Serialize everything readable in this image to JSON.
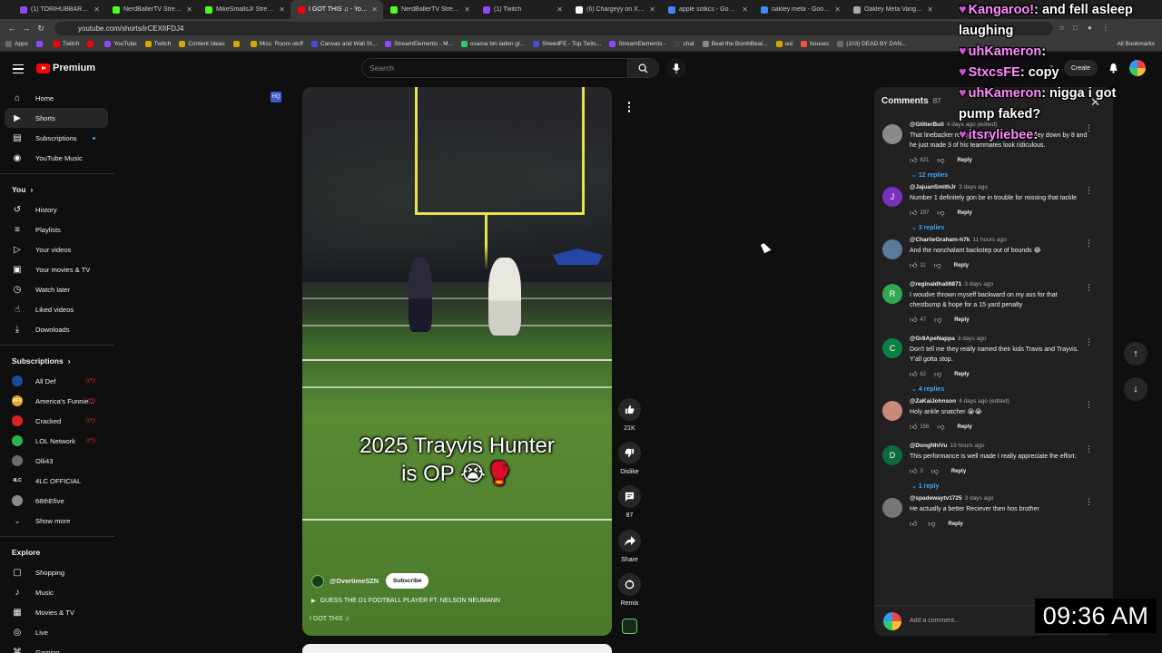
{
  "browser": {
    "tabs": [
      {
        "label": "(1) TORIHUBBARD - Twitc",
        "color": "#9146ff"
      },
      {
        "label": "NerdBallerTV Stream - W",
        "color": "#53fc18"
      },
      {
        "label": "MikeSmallsJr Stream - W",
        "color": "#53fc18"
      },
      {
        "label": "I GOT THIS ♫ - YouTu",
        "color": "#ff0000",
        "active": true
      },
      {
        "label": "NerdBallerTV Stream - W",
        "color": "#53fc18"
      },
      {
        "label": "(1) Twitch",
        "color": "#9146ff"
      },
      {
        "label": "(6) Chargeyy on X: \"Offic",
        "color": "#ffffff"
      },
      {
        "label": "apple sotkcs - Google Se",
        "color": "#4285f4"
      },
      {
        "label": "oakley meta - Google Sea",
        "color": "#4285f4"
      },
      {
        "label": "Oakley Meta Vanguard P",
        "color": "#aaaaaa"
      }
    ],
    "url": "youtube.com/shorts/irCEXItFDJ4",
    "bookmarks": [
      "Apps",
      "",
      "Twitch",
      "",
      "YouTube",
      "Twitch",
      "Content Ideas",
      "",
      "Misc. Room stuff",
      "Canvas and Wall St...",
      "StreamElements - M...",
      "osama bin laden gr...",
      "SheedFE - Top Twitc...",
      "StreamElements -",
      "chat",
      "Beat the BombBeat...",
      "ooi",
      "houses",
      "(103) DEAD BY DAN..."
    ],
    "all_bookmarks": "All Bookmarks"
  },
  "youtube": {
    "logo_text": "Premium",
    "search_placeholder": "Search",
    "header_counter": "2",
    "create_label": "Create"
  },
  "sidebar": {
    "top": [
      {
        "label": "Home",
        "icon": "home-icon"
      },
      {
        "label": "Shorts",
        "icon": "shorts-icon",
        "active": true
      },
      {
        "label": "Subscriptions",
        "icon": "subscriptions-icon",
        "dot": true
      },
      {
        "label": "YouTube Music",
        "icon": "music-icon"
      }
    ],
    "you_heading": "You",
    "you": [
      {
        "label": "History",
        "icon": "history-icon"
      },
      {
        "label": "Playlists",
        "icon": "playlists-icon"
      },
      {
        "label": "Your videos",
        "icon": "your-videos-icon"
      },
      {
        "label": "Your movies & TV",
        "icon": "movies-icon"
      },
      {
        "label": "Watch later",
        "icon": "watch-later-icon"
      },
      {
        "label": "Liked videos",
        "icon": "like-icon"
      },
      {
        "label": "Downloads",
        "icon": "download-icon"
      }
    ],
    "subs_heading": "Subscriptions",
    "subscriptions": [
      {
        "label": "All Def",
        "color": "#1b4ba0",
        "initials": "",
        "live": true
      },
      {
        "label": "America's Funnie...",
        "color": "#e3a521",
        "initials": "AFV",
        "live": true
      },
      {
        "label": "Cracked",
        "color": "#d22",
        "initials": "",
        "live": true
      },
      {
        "label": "LOL Network",
        "color": "#2bb24c",
        "initials": "",
        "live": true
      },
      {
        "label": "Olli43",
        "color": "#6a6a6a",
        "initials": ""
      },
      {
        "label": "4LC OFFICIAL",
        "color": "#111",
        "initials": "4LC"
      },
      {
        "label": "68thEfive",
        "color": "#888",
        "initials": ""
      }
    ],
    "show_more": "Show more",
    "explore_heading": "Explore",
    "explore": [
      {
        "label": "Shopping",
        "icon": "shopping-icon"
      },
      {
        "label": "Music",
        "icon": "music-note-icon"
      },
      {
        "label": "Movies & TV",
        "icon": "film-icon"
      },
      {
        "label": "Live",
        "icon": "live-icon"
      },
      {
        "label": "Gaming",
        "icon": "gaming-icon"
      }
    ]
  },
  "video": {
    "overlay_line1": "2025 Trayvis Hunter",
    "overlay_line2": "is OP 😭🥊",
    "channel": "@OvertimeSZN",
    "subscribe": "Subscribe",
    "description": "GUESS THE D1 FOOTBALL PLAYER FT. NELSON NEUMANN",
    "sound": "I GOT THIS ♫"
  },
  "actions": {
    "likes": "21K",
    "dislike": "Dislike",
    "comments": "87",
    "share": "Share",
    "remix": "Remix"
  },
  "comments_panel": {
    "title": "Comments",
    "count": "87",
    "add_placeholder": "Add a comment...",
    "items": [
      {
        "user": "@GlitterBull",
        "time": "4 days ago (edited)",
        "text": "That linebacker really tried to size up when they down by 8 and he just made 3 of his teammates look ridiculous.",
        "likes": "821",
        "replies": "12 replies",
        "avatar": "#8a8a8a",
        "initial": ""
      },
      {
        "user": "@JajuanSmithJr",
        "time": "3 days ago",
        "text": "Number 1 definitely gon be in trouble for missing that tackle",
        "likes": "297",
        "replies": "3 replies",
        "avatar": "#7b2fbe",
        "initial": "J"
      },
      {
        "user": "@CharlieGraham-h7k",
        "time": "11 hours ago",
        "text": "And the nonchalant backstep out of bounds 😂",
        "likes": "11",
        "replies": "",
        "avatar": "#5a7a9a",
        "initial": ""
      },
      {
        "user": "@reginaldhall6871",
        "time": "3 days ago",
        "text": "I woudve thrown myself backward on my ass for that chestbump & hope for a 15 yard penalty",
        "likes": "47",
        "replies": "",
        "avatar": "#33a853",
        "initial": "R"
      },
      {
        "user": "@Gr8ApeNappa",
        "time": "3 days ago",
        "text": "Don't tell me they really named their kids Travis and Trayvis. Y'all gotta stop.",
        "likes": "62",
        "replies": "4 replies",
        "avatar": "#0b8043",
        "initial": "C"
      },
      {
        "user": "@ZaKaiJohnson",
        "time": "4 days ago (edited)",
        "text": "Holy ankle snatcher 😭😭",
        "likes": "156",
        "replies": "",
        "avatar": "#c98a7a",
        "initial": ""
      },
      {
        "user": "@DongNhiVu",
        "time": "19 hours ago",
        "text": "This performance is well made I really appreciate the effort.",
        "likes": "3",
        "replies": "1 reply",
        "avatar": "#0b6b3a",
        "initial": "D"
      },
      {
        "user": "@spadewaytv1725",
        "time": "3 days ago",
        "text": "He actually a better Reciever then hos brother",
        "likes": "",
        "replies": "",
        "avatar": "#777",
        "initial": ""
      }
    ]
  },
  "reply_label": "Reply",
  "stream_chat": [
    {
      "user": "Kangaroo!",
      "msg": ": and fell asleep"
    },
    {
      "user": "",
      "msg": "laughing"
    },
    {
      "user": "uhKameron",
      "msg": ":"
    },
    {
      "user": "StxcsFE",
      "msg": ": copy"
    },
    {
      "user": "uhKameron",
      "msg": ": nigga i got"
    },
    {
      "user": "",
      "msg": "pump faked?"
    },
    {
      "user": "itsryliebee",
      "msg": ":"
    }
  ],
  "clock": "09:36 AM"
}
